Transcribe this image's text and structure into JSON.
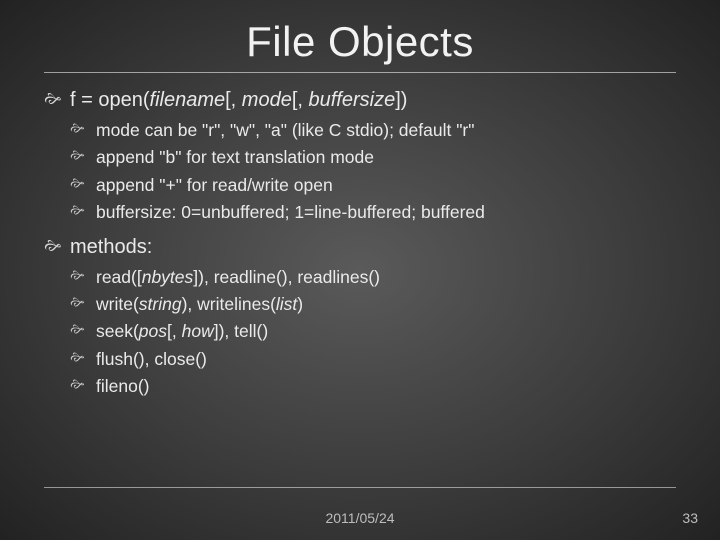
{
  "title": "File Objects",
  "section1": {
    "head_pre": "f = open(",
    "head_arg1": "filename",
    "head_mid1": "[, ",
    "head_arg2": "mode",
    "head_mid2": "[, ",
    "head_arg3": "buffersize",
    "head_post": "])",
    "items": [
      "mode can be \"r\", \"w\", \"a\" (like C stdio); default \"r\"",
      "append \"b\" for text translation mode",
      "append \"+\" for read/write open",
      "buffersize: 0=unbuffered; 1=line-buffered; buffered"
    ]
  },
  "section2": {
    "head": "methods:",
    "m0_a": "read([",
    "m0_b": "nbytes",
    "m0_c": "]), readline(), readlines()",
    "m1_a": "write(",
    "m1_b": "string",
    "m1_c": "), writelines(",
    "m1_d": "list",
    "m1_e": ")",
    "m2_a": "seek(",
    "m2_b": "pos",
    "m2_c": "[, ",
    "m2_d": "how",
    "m2_e": "]), tell()",
    "m3": "flush(), close()",
    "m4": "fileno()"
  },
  "footer": {
    "date": "2011/05/24",
    "page": "33"
  }
}
